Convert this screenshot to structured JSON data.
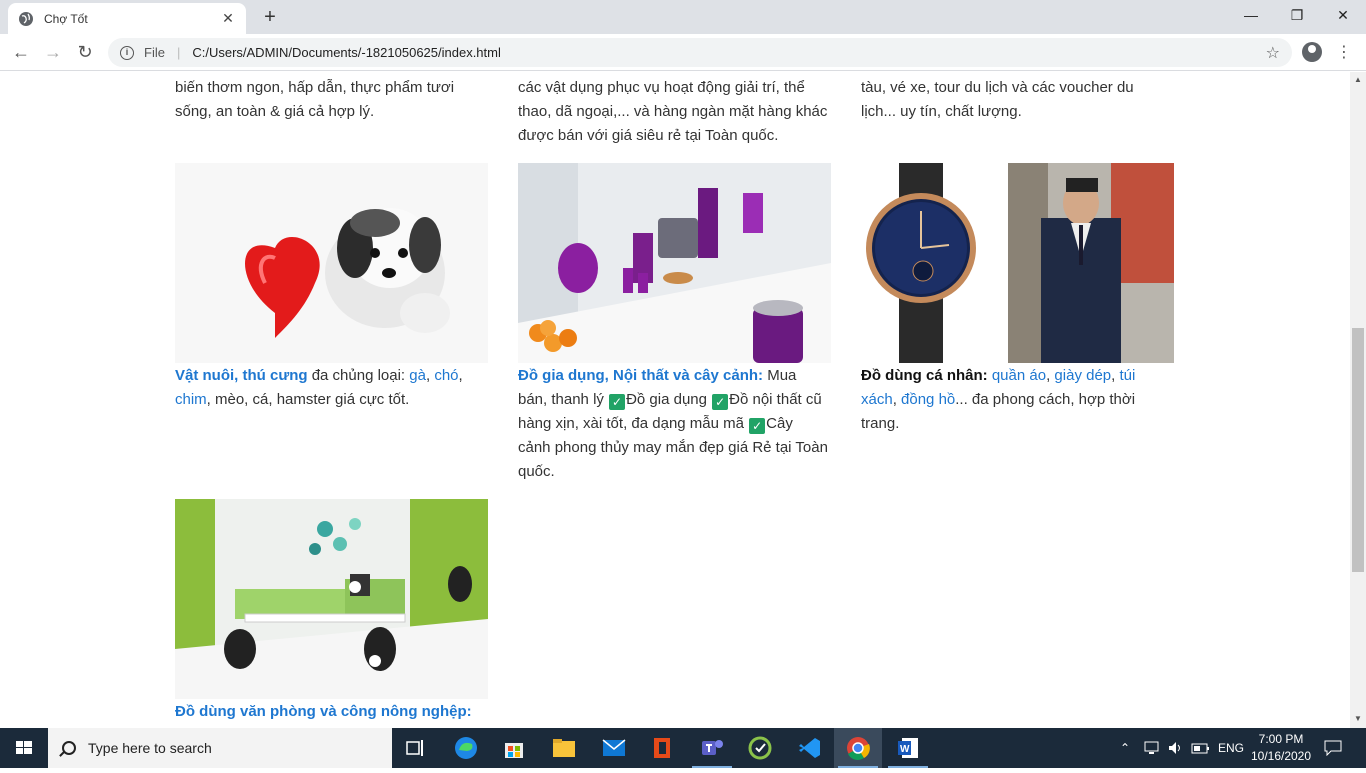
{
  "browser": {
    "tab_title": "Chợ Tốt",
    "new_tab": "+",
    "scheme": "File",
    "url": "C:/Users/ADMIN/Documents/-1821050625/index.html"
  },
  "content": {
    "top": {
      "col1": "biến thơm ngon, hấp dẫn, thực phẩm tươi sống, an toàn & giá cả hợp lý.",
      "col2": "các vật dụng phục vụ hoạt động giải trí, thể thao, dã ngoại,... và hàng ngàn mặt hàng khác được bán với giá siêu rẻ tại Toàn quốc.",
      "col3": "tàu, vé xe, tour du lịch và các voucher du lịch... uy tín, chất lượng."
    },
    "pets": {
      "title": "Vật nuôi, thú cưng",
      "t1": " đa chủng loại: ",
      "l1": "gà",
      "c1": ", ",
      "l2": "chó",
      "c2": ", ",
      "l3": "chim",
      "t2": ", mèo, cá, hamster giá cực tốt."
    },
    "household": {
      "title": "Đồ gia dụng, Nội thất và cây cảnh:",
      "t1": " Mua bán, thanh lý ",
      "t2": "Đồ gia dụng ",
      "t3": "Đồ nội thất cũ hàng xịn, xài tốt, đa dạng mẫu mã ",
      "t4": "Cây cảnh phong thủy may mắn đẹp giá Rẻ tại Toàn quốc.",
      "check": "✓"
    },
    "personal": {
      "title": "Đồ dùng cá nhân:",
      "l1": "quần áo",
      "c1": ", ",
      "l2": "giày dép",
      "c2": ", ",
      "l3": "túi xách",
      "c3": ", ",
      "l4": "đồng hồ",
      "t1": "... đa phong cách, hợp thời trang."
    },
    "office": {
      "title": "Đồ dùng văn phòng và công nông nghệp:"
    }
  },
  "taskbar": {
    "search_placeholder": "Type here to search",
    "lang": "ENG",
    "time": "7:00 PM",
    "date": "10/16/2020"
  },
  "colors": {
    "link": "#1e77d0",
    "taskbar": "#1b2a3a"
  }
}
